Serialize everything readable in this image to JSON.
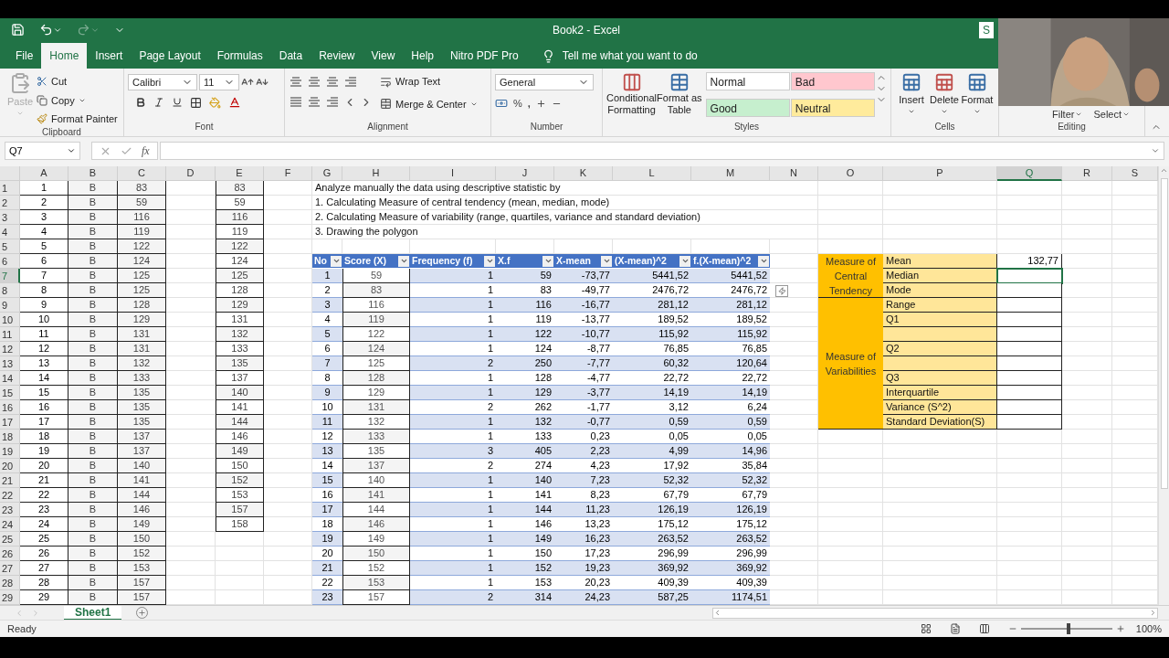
{
  "title_bar": {
    "title": "Book2 - Excel",
    "share_label": "S"
  },
  "menu_tabs": [
    {
      "label": "File",
      "selected": false
    },
    {
      "label": "Home",
      "selected": true
    },
    {
      "label": "Insert",
      "selected": false
    },
    {
      "label": "Page Layout",
      "selected": false
    },
    {
      "label": "Formulas",
      "selected": false
    },
    {
      "label": "Data",
      "selected": false
    },
    {
      "label": "Review",
      "selected": false
    },
    {
      "label": "View",
      "selected": false
    },
    {
      "label": "Help",
      "selected": false
    },
    {
      "label": "Nitro PDF Pro",
      "selected": false
    }
  ],
  "tell_me": "Tell me what you want to do",
  "ribbon": {
    "clipboard": {
      "label": "Clipboard",
      "paste": "Paste",
      "cut": "Cut",
      "copy": "Copy",
      "format_painter": "Format Painter"
    },
    "font": {
      "label": "Font",
      "name": "Calibri",
      "size": "11"
    },
    "alignment": {
      "label": "Alignment",
      "wrap_text": "Wrap Text",
      "merge": "Merge & Center"
    },
    "number": {
      "label": "Number",
      "format": "General",
      "percent": "%",
      "comma": ","
    },
    "styles": {
      "label": "Styles",
      "conditional": [
        "Conditional",
        "Formatting"
      ],
      "format_table": [
        "Format as",
        "Table"
      ],
      "cell_styles": [
        {
          "label": "Normal",
          "color": "#ffffff"
        },
        {
          "label": "Bad",
          "color": "#ffc7ce"
        },
        {
          "label": "Good",
          "color": "#c6efce"
        },
        {
          "label": "Neutral",
          "color": "#ffeb9c"
        }
      ]
    },
    "cells": {
      "label": "Cells",
      "buttons": [
        "Insert",
        "Delete",
        "Format"
      ]
    },
    "editing": {
      "label": "Editing",
      "buttons": [
        "Filter",
        "Select"
      ]
    }
  },
  "formula_bar": {
    "name_box": "Q7",
    "fx": "fx"
  },
  "sheet": {
    "columns": [
      {
        "label": "A",
        "selected": false
      },
      {
        "label": "B",
        "selected": false
      },
      {
        "label": "C",
        "selected": false
      },
      {
        "label": "D",
        "selected": false
      },
      {
        "label": "E",
        "selected": false
      },
      {
        "label": "F",
        "selected": false
      },
      {
        "label": "G",
        "selected": false
      },
      {
        "label": "H",
        "selected": false
      },
      {
        "label": "I",
        "selected": false
      },
      {
        "label": "J",
        "selected": false
      },
      {
        "label": "K",
        "selected": false
      },
      {
        "label": "L",
        "selected": false
      },
      {
        "label": "M",
        "selected": false
      },
      {
        "label": "N",
        "selected": false
      },
      {
        "label": "O",
        "selected": false
      },
      {
        "label": "P",
        "selected": false
      },
      {
        "label": "Q",
        "selected": true
      },
      {
        "label": "R",
        "selected": false
      },
      {
        "label": "S",
        "selected": false
      }
    ],
    "row_numbers": [
      {
        "label": "1",
        "selected": false
      },
      {
        "label": "2",
        "selected": false
      },
      {
        "label": "3",
        "selected": false
      },
      {
        "label": "4",
        "selected": false
      },
      {
        "label": "5",
        "selected": false
      },
      {
        "label": "6",
        "selected": false
      },
      {
        "label": "7",
        "selected": true
      },
      {
        "label": "8",
        "selected": false
      },
      {
        "label": "9",
        "selected": false
      },
      {
        "label": "10",
        "selected": false
      },
      {
        "label": "11",
        "selected": false
      },
      {
        "label": "12",
        "selected": false
      },
      {
        "label": "13",
        "selected": false
      },
      {
        "label": "14",
        "selected": false
      },
      {
        "label": "15",
        "selected": false
      },
      {
        "label": "16",
        "selected": false
      },
      {
        "label": "17",
        "selected": false
      },
      {
        "label": "18",
        "selected": false
      },
      {
        "label": "19",
        "selected": false
      },
      {
        "label": "20",
        "selected": false
      },
      {
        "label": "21",
        "selected": false
      },
      {
        "label": "22",
        "selected": false
      },
      {
        "label": "23",
        "selected": false
      },
      {
        "label": "24",
        "selected": false
      },
      {
        "label": "25",
        "selected": false
      },
      {
        "label": "26",
        "selected": false
      },
      {
        "label": "27",
        "selected": false
      },
      {
        "label": "28",
        "selected": false
      },
      {
        "label": "29",
        "selected": false
      }
    ],
    "left_rows": [
      {
        "column_a": "1",
        "column_b": "B",
        "column_c": "83",
        "column_e": "83"
      },
      {
        "column_a": "2",
        "column_b": "B",
        "column_c": "59",
        "column_e": "59"
      },
      {
        "column_a": "3",
        "column_b": "B",
        "column_c": "116",
        "column_e": "116"
      },
      {
        "column_a": "4",
        "column_b": "B",
        "column_c": "119",
        "column_e": "119"
      },
      {
        "column_a": "5",
        "column_b": "B",
        "column_c": "122",
        "column_e": "122"
      },
      {
        "column_a": "6",
        "column_b": "B",
        "column_c": "124",
        "column_e": "124"
      },
      {
        "column_a": "7",
        "column_b": "B",
        "column_c": "125",
        "column_e": "125"
      },
      {
        "column_a": "8",
        "column_b": "B",
        "column_c": "125",
        "column_e": "128"
      },
      {
        "column_a": "9",
        "column_b": "B",
        "column_c": "128",
        "column_e": "129"
      },
      {
        "column_a": "10",
        "column_b": "B",
        "column_c": "129",
        "column_e": "131"
      },
      {
        "column_a": "11",
        "column_b": "B",
        "column_c": "131",
        "column_e": "132"
      },
      {
        "column_a": "12",
        "column_b": "B",
        "column_c": "131",
        "column_e": "133"
      },
      {
        "column_a": "13",
        "column_b": "B",
        "column_c": "132",
        "column_e": "135"
      },
      {
        "column_a": "14",
        "column_b": "B",
        "column_c": "133",
        "column_e": "137"
      },
      {
        "column_a": "15",
        "column_b": "B",
        "column_c": "135",
        "column_e": "140"
      },
      {
        "column_a": "16",
        "column_b": "B",
        "column_c": "135",
        "column_e": "141"
      },
      {
        "column_a": "17",
        "column_b": "B",
        "column_c": "135",
        "column_e": "144"
      },
      {
        "column_a": "18",
        "column_b": "B",
        "column_c": "137",
        "column_e": "146"
      },
      {
        "column_a": "19",
        "column_b": "B",
        "column_c": "137",
        "column_e": "149"
      },
      {
        "column_a": "20",
        "column_b": "B",
        "column_c": "140",
        "column_e": "150"
      },
      {
        "column_a": "21",
        "column_b": "B",
        "column_c": "141",
        "column_e": "152"
      },
      {
        "column_a": "22",
        "column_b": "B",
        "column_c": "144",
        "column_e": "153"
      },
      {
        "column_a": "23",
        "column_b": "B",
        "column_c": "146",
        "column_e": "157"
      },
      {
        "column_a": "24",
        "column_b": "B",
        "column_c": "149",
        "column_e": "158"
      },
      {
        "column_a": "25",
        "column_b": "B",
        "column_c": "150"
      },
      {
        "column_a": "26",
        "column_b": "B",
        "column_c": "152"
      },
      {
        "column_a": "27",
        "column_b": "B",
        "column_c": "153"
      },
      {
        "column_a": "28",
        "column_b": "B",
        "column_c": "157"
      },
      {
        "column_a": "29",
        "column_b": "B",
        "column_c": "157"
      }
    ],
    "notes": [
      "Analyze manually the data using descriptive statistic by",
      "1. Calculating Measure of central tendency (mean, median, mode)",
      "2. Calculating Measure of variability (range, quartiles, variance and standard deviation)",
      "3. Drawing the polygon"
    ],
    "frequency_table": {
      "columns": [
        "No",
        "Score (X)",
        "Frequency (f)",
        "X.f",
        "X-mean",
        "(X-mean)^2",
        "f.(X-mean)^2"
      ],
      "rows": [
        [
          "1",
          "59",
          "1",
          "59",
          "-73,77",
          "5441,52",
          "5441,52"
        ],
        [
          "2",
          "83",
          "1",
          "83",
          "-49,77",
          "2476,72",
          "2476,72"
        ],
        [
          "3",
          "116",
          "1",
          "116",
          "-16,77",
          "281,12",
          "281,12"
        ],
        [
          "4",
          "119",
          "1",
          "119",
          "-13,77",
          "189,52",
          "189,52"
        ],
        [
          "5",
          "122",
          "1",
          "122",
          "-10,77",
          "115,92",
          "115,92"
        ],
        [
          "6",
          "124",
          "1",
          "124",
          "-8,77",
          "76,85",
          "76,85"
        ],
        [
          "7",
          "125",
          "2",
          "250",
          "-7,77",
          "60,32",
          "120,64"
        ],
        [
          "8",
          "128",
          "1",
          "128",
          "-4,77",
          "22,72",
          "22,72"
        ],
        [
          "9",
          "129",
          "1",
          "129",
          "-3,77",
          "14,19",
          "14,19"
        ],
        [
          "10",
          "131",
          "2",
          "262",
          "-1,77",
          "3,12",
          "6,24"
        ],
        [
          "11",
          "132",
          "1",
          "132",
          "-0,77",
          "0,59",
          "0,59"
        ],
        [
          "12",
          "133",
          "1",
          "133",
          "0,23",
          "0,05",
          "0,05"
        ],
        [
          "13",
          "135",
          "3",
          "405",
          "2,23",
          "4,99",
          "14,96"
        ],
        [
          "14",
          "137",
          "2",
          "274",
          "4,23",
          "17,92",
          "35,84"
        ],
        [
          "15",
          "140",
          "1",
          "140",
          "7,23",
          "52,32",
          "52,32"
        ],
        [
          "16",
          "141",
          "1",
          "141",
          "8,23",
          "67,79",
          "67,79"
        ],
        [
          "17",
          "144",
          "1",
          "144",
          "11,23",
          "126,19",
          "126,19"
        ],
        [
          "18",
          "146",
          "1",
          "146",
          "13,23",
          "175,12",
          "175,12"
        ],
        [
          "19",
          "149",
          "1",
          "149",
          "16,23",
          "263,52",
          "263,52"
        ],
        [
          "20",
          "150",
          "1",
          "150",
          "17,23",
          "296,99",
          "296,99"
        ],
        [
          "21",
          "152",
          "1",
          "152",
          "19,23",
          "369,92",
          "369,92"
        ],
        [
          "22",
          "153",
          "1",
          "153",
          "20,23",
          "409,39",
          "409,39"
        ],
        [
          "23",
          "157",
          "2",
          "314",
          "24,23",
          "587,25",
          "1174,51"
        ]
      ]
    },
    "summary_table": [
      {
        "label": "Measure of Central Tendency",
        "rows": [
          {
            "label": "Mean",
            "value": "132,77",
            "selected": false
          },
          {
            "label": "Median",
            "selected": true
          },
          {
            "label": "Mode",
            "selected": false
          }
        ]
      },
      {
        "label": "Measure of Variabilities",
        "rows": [
          {
            "label": "Range",
            "selected": false
          },
          {
            "label": "Q1",
            "selected": false
          },
          {
            "selected": false
          },
          {
            "label": "Q2",
            "selected": false
          },
          {
            "selected": false
          },
          {
            "label": "Q3",
            "selected": false
          },
          {
            "label": "Interquartile",
            "selected": false
          },
          {
            "label": "Variance (S^2)",
            "selected": false
          },
          {
            "label": "Standard Deviation(S)",
            "selected": false
          }
        ]
      }
    ]
  },
  "sheet_tabs": [
    {
      "label": "Sheet1",
      "selected": true
    }
  ],
  "status_bar": {
    "status": "Ready",
    "zoom": {
      "level": 0.5,
      "reading": "100%"
    }
  }
}
